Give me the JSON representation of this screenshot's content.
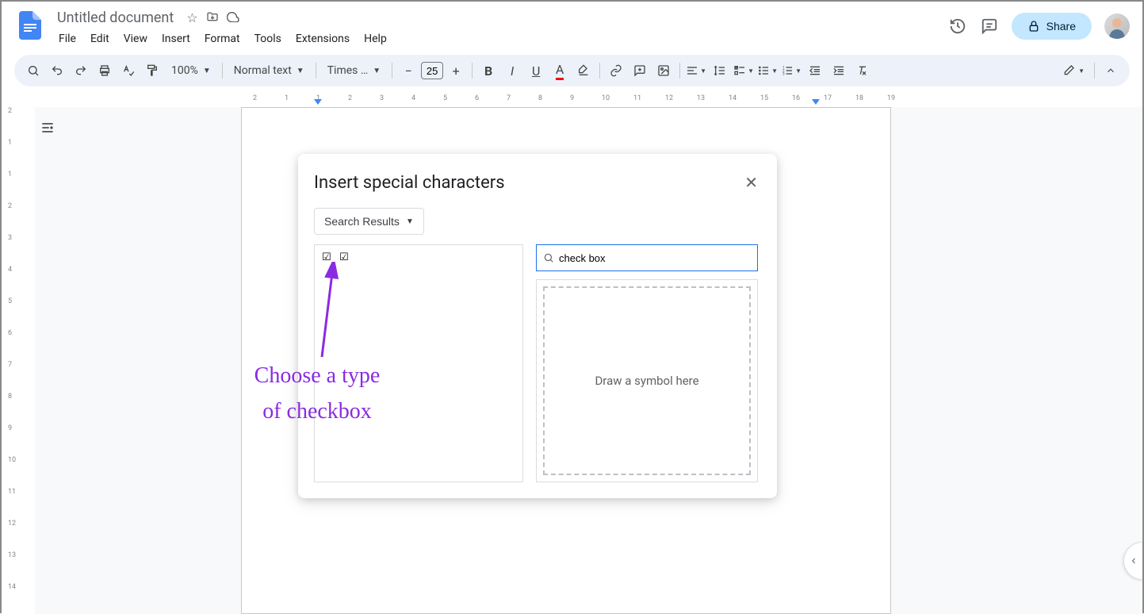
{
  "header": {
    "doc_title": "Untitled document",
    "menus": [
      "File",
      "Edit",
      "View",
      "Insert",
      "Format",
      "Tools",
      "Extensions",
      "Help"
    ],
    "share_label": "Share"
  },
  "toolbar": {
    "zoom": "100%",
    "style_select": "Normal text",
    "font_select": "Times …",
    "font_size": "25"
  },
  "ruler": {
    "marks": [
      "2",
      "1",
      "1",
      "2",
      "3",
      "4",
      "5",
      "6",
      "7",
      "8",
      "9",
      "10",
      "11",
      "12",
      "13",
      "14",
      "15",
      "16",
      "17",
      "18",
      "19"
    ],
    "vmarks": [
      "2",
      "1",
      "1",
      "2",
      "3",
      "4",
      "5",
      "6",
      "7",
      "8",
      "9",
      "10",
      "11",
      "12",
      "13",
      "14"
    ]
  },
  "dialog": {
    "title": "Insert special characters",
    "dropdown_label": "Search Results",
    "search_value": "check box",
    "draw_placeholder": "Draw a symbol here",
    "results": [
      "☑",
      "☑"
    ]
  },
  "annotation": {
    "line1": "Choose a type",
    "line2": "of checkbox"
  }
}
